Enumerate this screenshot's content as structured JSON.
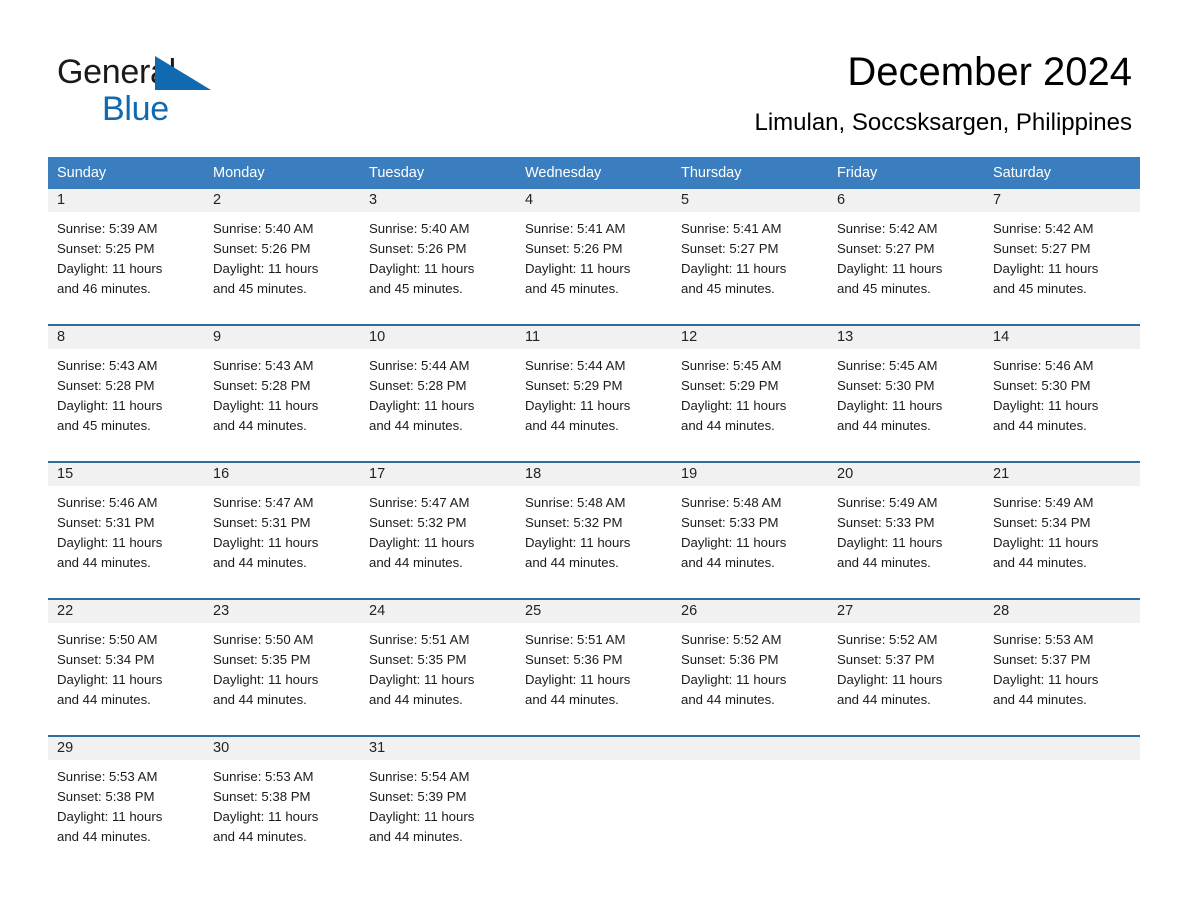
{
  "brand": {
    "name_line1": "General",
    "name_line2": "Blue",
    "triangle_color": "#1169b0"
  },
  "header": {
    "title": "December 2024",
    "subtitle": "Limulan, Soccsksargen, Philippines"
  },
  "colors": {
    "header_blue": "#3a7ebf",
    "row_border_blue": "#2e6da4",
    "day_band_gray": "#f1f1f1",
    "brand_blue": "#1169b0"
  },
  "weekdays": [
    "Sunday",
    "Monday",
    "Tuesday",
    "Wednesday",
    "Thursday",
    "Friday",
    "Saturday"
  ],
  "weeks": [
    [
      {
        "day": "1",
        "sunrise": "Sunrise: 5:39 AM",
        "sunset": "Sunset: 5:25 PM",
        "daylight_1": "Daylight: 11 hours",
        "daylight_2": "and 46 minutes."
      },
      {
        "day": "2",
        "sunrise": "Sunrise: 5:40 AM",
        "sunset": "Sunset: 5:26 PM",
        "daylight_1": "Daylight: 11 hours",
        "daylight_2": "and 45 minutes."
      },
      {
        "day": "3",
        "sunrise": "Sunrise: 5:40 AM",
        "sunset": "Sunset: 5:26 PM",
        "daylight_1": "Daylight: 11 hours",
        "daylight_2": "and 45 minutes."
      },
      {
        "day": "4",
        "sunrise": "Sunrise: 5:41 AM",
        "sunset": "Sunset: 5:26 PM",
        "daylight_1": "Daylight: 11 hours",
        "daylight_2": "and 45 minutes."
      },
      {
        "day": "5",
        "sunrise": "Sunrise: 5:41 AM",
        "sunset": "Sunset: 5:27 PM",
        "daylight_1": "Daylight: 11 hours",
        "daylight_2": "and 45 minutes."
      },
      {
        "day": "6",
        "sunrise": "Sunrise: 5:42 AM",
        "sunset": "Sunset: 5:27 PM",
        "daylight_1": "Daylight: 11 hours",
        "daylight_2": "and 45 minutes."
      },
      {
        "day": "7",
        "sunrise": "Sunrise: 5:42 AM",
        "sunset": "Sunset: 5:27 PM",
        "daylight_1": "Daylight: 11 hours",
        "daylight_2": "and 45 minutes."
      }
    ],
    [
      {
        "day": "8",
        "sunrise": "Sunrise: 5:43 AM",
        "sunset": "Sunset: 5:28 PM",
        "daylight_1": "Daylight: 11 hours",
        "daylight_2": "and 45 minutes."
      },
      {
        "day": "9",
        "sunrise": "Sunrise: 5:43 AM",
        "sunset": "Sunset: 5:28 PM",
        "daylight_1": "Daylight: 11 hours",
        "daylight_2": "and 44 minutes."
      },
      {
        "day": "10",
        "sunrise": "Sunrise: 5:44 AM",
        "sunset": "Sunset: 5:28 PM",
        "daylight_1": "Daylight: 11 hours",
        "daylight_2": "and 44 minutes."
      },
      {
        "day": "11",
        "sunrise": "Sunrise: 5:44 AM",
        "sunset": "Sunset: 5:29 PM",
        "daylight_1": "Daylight: 11 hours",
        "daylight_2": "and 44 minutes."
      },
      {
        "day": "12",
        "sunrise": "Sunrise: 5:45 AM",
        "sunset": "Sunset: 5:29 PM",
        "daylight_1": "Daylight: 11 hours",
        "daylight_2": "and 44 minutes."
      },
      {
        "day": "13",
        "sunrise": "Sunrise: 5:45 AM",
        "sunset": "Sunset: 5:30 PM",
        "daylight_1": "Daylight: 11 hours",
        "daylight_2": "and 44 minutes."
      },
      {
        "day": "14",
        "sunrise": "Sunrise: 5:46 AM",
        "sunset": "Sunset: 5:30 PM",
        "daylight_1": "Daylight: 11 hours",
        "daylight_2": "and 44 minutes."
      }
    ],
    [
      {
        "day": "15",
        "sunrise": "Sunrise: 5:46 AM",
        "sunset": "Sunset: 5:31 PM",
        "daylight_1": "Daylight: 11 hours",
        "daylight_2": "and 44 minutes."
      },
      {
        "day": "16",
        "sunrise": "Sunrise: 5:47 AM",
        "sunset": "Sunset: 5:31 PM",
        "daylight_1": "Daylight: 11 hours",
        "daylight_2": "and 44 minutes."
      },
      {
        "day": "17",
        "sunrise": "Sunrise: 5:47 AM",
        "sunset": "Sunset: 5:32 PM",
        "daylight_1": "Daylight: 11 hours",
        "daylight_2": "and 44 minutes."
      },
      {
        "day": "18",
        "sunrise": "Sunrise: 5:48 AM",
        "sunset": "Sunset: 5:32 PM",
        "daylight_1": "Daylight: 11 hours",
        "daylight_2": "and 44 minutes."
      },
      {
        "day": "19",
        "sunrise": "Sunrise: 5:48 AM",
        "sunset": "Sunset: 5:33 PM",
        "daylight_1": "Daylight: 11 hours",
        "daylight_2": "and 44 minutes."
      },
      {
        "day": "20",
        "sunrise": "Sunrise: 5:49 AM",
        "sunset": "Sunset: 5:33 PM",
        "daylight_1": "Daylight: 11 hours",
        "daylight_2": "and 44 minutes."
      },
      {
        "day": "21",
        "sunrise": "Sunrise: 5:49 AM",
        "sunset": "Sunset: 5:34 PM",
        "daylight_1": "Daylight: 11 hours",
        "daylight_2": "and 44 minutes."
      }
    ],
    [
      {
        "day": "22",
        "sunrise": "Sunrise: 5:50 AM",
        "sunset": "Sunset: 5:34 PM",
        "daylight_1": "Daylight: 11 hours",
        "daylight_2": "and 44 minutes."
      },
      {
        "day": "23",
        "sunrise": "Sunrise: 5:50 AM",
        "sunset": "Sunset: 5:35 PM",
        "daylight_1": "Daylight: 11 hours",
        "daylight_2": "and 44 minutes."
      },
      {
        "day": "24",
        "sunrise": "Sunrise: 5:51 AM",
        "sunset": "Sunset: 5:35 PM",
        "daylight_1": "Daylight: 11 hours",
        "daylight_2": "and 44 minutes."
      },
      {
        "day": "25",
        "sunrise": "Sunrise: 5:51 AM",
        "sunset": "Sunset: 5:36 PM",
        "daylight_1": "Daylight: 11 hours",
        "daylight_2": "and 44 minutes."
      },
      {
        "day": "26",
        "sunrise": "Sunrise: 5:52 AM",
        "sunset": "Sunset: 5:36 PM",
        "daylight_1": "Daylight: 11 hours",
        "daylight_2": "and 44 minutes."
      },
      {
        "day": "27",
        "sunrise": "Sunrise: 5:52 AM",
        "sunset": "Sunset: 5:37 PM",
        "daylight_1": "Daylight: 11 hours",
        "daylight_2": "and 44 minutes."
      },
      {
        "day": "28",
        "sunrise": "Sunrise: 5:53 AM",
        "sunset": "Sunset: 5:37 PM",
        "daylight_1": "Daylight: 11 hours",
        "daylight_2": "and 44 minutes."
      }
    ],
    [
      {
        "day": "29",
        "sunrise": "Sunrise: 5:53 AM",
        "sunset": "Sunset: 5:38 PM",
        "daylight_1": "Daylight: 11 hours",
        "daylight_2": "and 44 minutes."
      },
      {
        "day": "30",
        "sunrise": "Sunrise: 5:53 AM",
        "sunset": "Sunset: 5:38 PM",
        "daylight_1": "Daylight: 11 hours",
        "daylight_2": "and 44 minutes."
      },
      {
        "day": "31",
        "sunrise": "Sunrise: 5:54 AM",
        "sunset": "Sunset: 5:39 PM",
        "daylight_1": "Daylight: 11 hours",
        "daylight_2": "and 44 minutes."
      },
      {
        "day": "",
        "sunrise": "",
        "sunset": "",
        "daylight_1": "",
        "daylight_2": ""
      },
      {
        "day": "",
        "sunrise": "",
        "sunset": "",
        "daylight_1": "",
        "daylight_2": ""
      },
      {
        "day": "",
        "sunrise": "",
        "sunset": "",
        "daylight_1": "",
        "daylight_2": ""
      },
      {
        "day": "",
        "sunrise": "",
        "sunset": "",
        "daylight_1": "",
        "daylight_2": ""
      }
    ]
  ]
}
